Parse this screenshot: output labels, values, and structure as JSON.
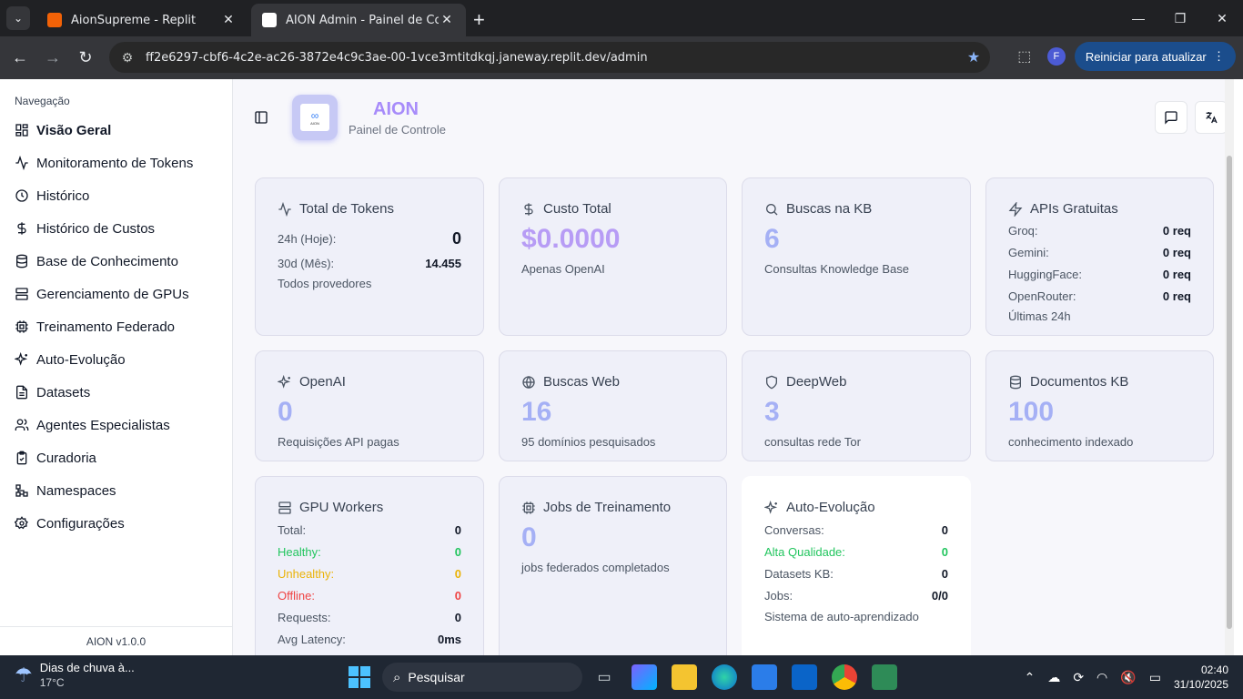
{
  "browser": {
    "tabs": [
      {
        "title": "AionSupreme - Replit",
        "active": false
      },
      {
        "title": "AION Admin - Painel de Controle",
        "active": true
      }
    ],
    "url": "ff2e6297-cbf6-4c2e-ac26-3872e4c9c3ae-00-1vce3mtitdkqj.janeway.replit.dev/admin",
    "profile_initial": "F",
    "update_label": "Reiniciar para atualizar"
  },
  "sidebar": {
    "title": "Navegação",
    "items": [
      {
        "label": "Visão Geral",
        "icon": "layout-grid-icon",
        "active": true
      },
      {
        "label": "Monitoramento de Tokens",
        "icon": "activity-icon"
      },
      {
        "label": "Histórico",
        "icon": "clock-icon"
      },
      {
        "label": "Histórico de Custos",
        "icon": "dollar-icon"
      },
      {
        "label": "Base de Conhecimento",
        "icon": "database-icon"
      },
      {
        "label": "Gerenciamento de GPUs",
        "icon": "server-icon"
      },
      {
        "label": "Treinamento Federado",
        "icon": "cpu-icon"
      },
      {
        "label": "Auto-Evolução",
        "icon": "sparkles-icon"
      },
      {
        "label": "Datasets",
        "icon": "file-icon"
      },
      {
        "label": "Agentes Especialistas",
        "icon": "users-icon"
      },
      {
        "label": "Curadoria",
        "icon": "clipboard-icon"
      },
      {
        "label": "Namespaces",
        "icon": "network-icon"
      },
      {
        "label": "Configurações",
        "icon": "gear-icon"
      }
    ],
    "footer": "AION v1.0.0"
  },
  "header": {
    "logo_text": "AION",
    "brand": "AION",
    "subtitle": "Painel de Controle"
  },
  "cards": {
    "tokens": {
      "title": "Total de Tokens",
      "r1_label": "24h (Hoje):",
      "r1_value": "0",
      "r2_label": "30d (Mês):",
      "r2_value": "14.455",
      "note": "Todos provedores"
    },
    "cost": {
      "title": "Custo Total",
      "value": "$0.0000",
      "note": "Apenas OpenAI"
    },
    "kb_search": {
      "title": "Buscas na KB",
      "value": "6",
      "note": "Consultas Knowledge Base"
    },
    "free_apis": {
      "title": "APIs Gratuitas",
      "rows": [
        {
          "label": "Groq:",
          "value": "0 req"
        },
        {
          "label": "Gemini:",
          "value": "0 req"
        },
        {
          "label": "HuggingFace:",
          "value": "0 req"
        },
        {
          "label": "OpenRouter:",
          "value": "0 req"
        }
      ],
      "note": "Últimas 24h"
    },
    "openai": {
      "title": "OpenAI",
      "value": "0",
      "note": "Requisições API pagas"
    },
    "web": {
      "title": "Buscas Web",
      "value": "16",
      "note": "95 domínios pesquisados"
    },
    "deepweb": {
      "title": "DeepWeb",
      "value": "3",
      "note": "consultas rede Tor"
    },
    "kb_docs": {
      "title": "Documentos KB",
      "value": "100",
      "note": "conhecimento indexado"
    },
    "gpu": {
      "title": "GPU Workers",
      "rows": [
        {
          "label": "Total:",
          "value": "0",
          "color": "#4b5563"
        },
        {
          "label": "Healthy:",
          "value": "0",
          "color": "#22c55e"
        },
        {
          "label": "Unhealthy:",
          "value": "0",
          "color": "#eab308"
        },
        {
          "label": "Offline:",
          "value": "0",
          "color": "#ef4444"
        },
        {
          "label": "Requests:",
          "value": "0",
          "color": "#4b5563"
        },
        {
          "label": "Avg Latency:",
          "value": "0ms",
          "color": "#4b5563"
        }
      ]
    },
    "jobs": {
      "title": "Jobs de Treinamento",
      "value": "0",
      "note": "jobs federados completados"
    },
    "evolution": {
      "title": "Auto-Evolução",
      "rows": [
        {
          "label": "Conversas:",
          "value": "0",
          "color": "#4b5563"
        },
        {
          "label": "Alta Qualidade:",
          "value": "0",
          "color": "#22c55e"
        },
        {
          "label": "Datasets KB:",
          "value": "0",
          "color": "#4b5563"
        },
        {
          "label": "Jobs:",
          "value": "0/0",
          "color": "#4b5563"
        }
      ],
      "note": "Sistema de auto-aprendizado"
    }
  },
  "taskbar": {
    "weather_title": "Dias de chuva à...",
    "weather_temp": "17°C",
    "search_placeholder": "Pesquisar",
    "time": "02:40",
    "date": "31/10/2025"
  }
}
